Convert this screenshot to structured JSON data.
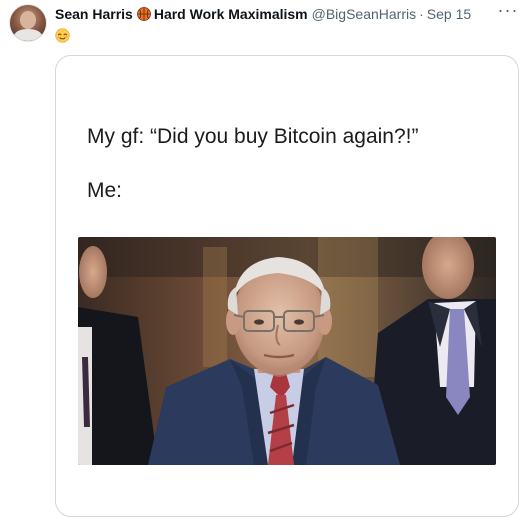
{
  "author": {
    "display_name": "Sean Harris",
    "suffix": "Hard Work Maximalism",
    "handle": "@BigSeanHarris",
    "separator": "·",
    "timestamp": "Sep 15"
  },
  "tweet": {
    "emoji": "relieved-face",
    "more_label": "···"
  },
  "meme": {
    "line1": "My gf: “Did you buy Bitcoin again?!”",
    "line2": "Me:",
    "photo": "older-man-in-suit-with-red-tie"
  },
  "colors": {
    "text_primary": "#0f1419",
    "text_secondary": "#536471",
    "card_border": "#cfd9de",
    "basketball": "#e8702a",
    "tie": "#a8363c"
  }
}
